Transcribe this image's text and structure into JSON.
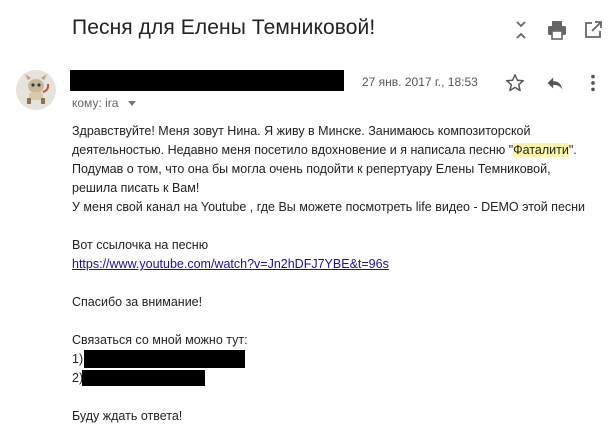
{
  "subject": "Песня для Елены Темниковой!",
  "toolbar_icons": [
    "collapse-all-icon",
    "print-icon",
    "open-in-new-window-icon"
  ],
  "header": {
    "date": "27 янв. 2017 г., 18:53",
    "recipient_prefix": "кому:",
    "recipient": "ira",
    "icons": [
      "star-icon",
      "reply-icon",
      "more-vert-icon"
    ]
  },
  "body": {
    "greeting": "Здравствуйте! Меня зовут Нина. Я живу в Минске. Занимаюсь композиторской",
    "line2_before": "деятельностью. Недавно меня посетило вдохновение и я написала песню \"",
    "line2_highlight": "Фаталити",
    "line2_after": "\".",
    "line3": "Подумав о том, что она бы могла очень подойти к репертуару Елены Темниковой,",
    "line4": "решила писать к Вам!",
    "line5": "У меня свой канал на Youtube , где Вы можете посмотреть life видео - DEMO этой песни",
    "link_intro": "Вот ссылочка на песню",
    "link": "https://www.youtube.com/watch?v=Jn2hDFJ7YBE&t=96s",
    "thanks": "Спасибо за внимание!",
    "contact_intro": "Связаться со мной можно тут:",
    "contact_1_label": "1)",
    "contact_2_label": "2)",
    "closing": "Буду ждать ответа!"
  }
}
